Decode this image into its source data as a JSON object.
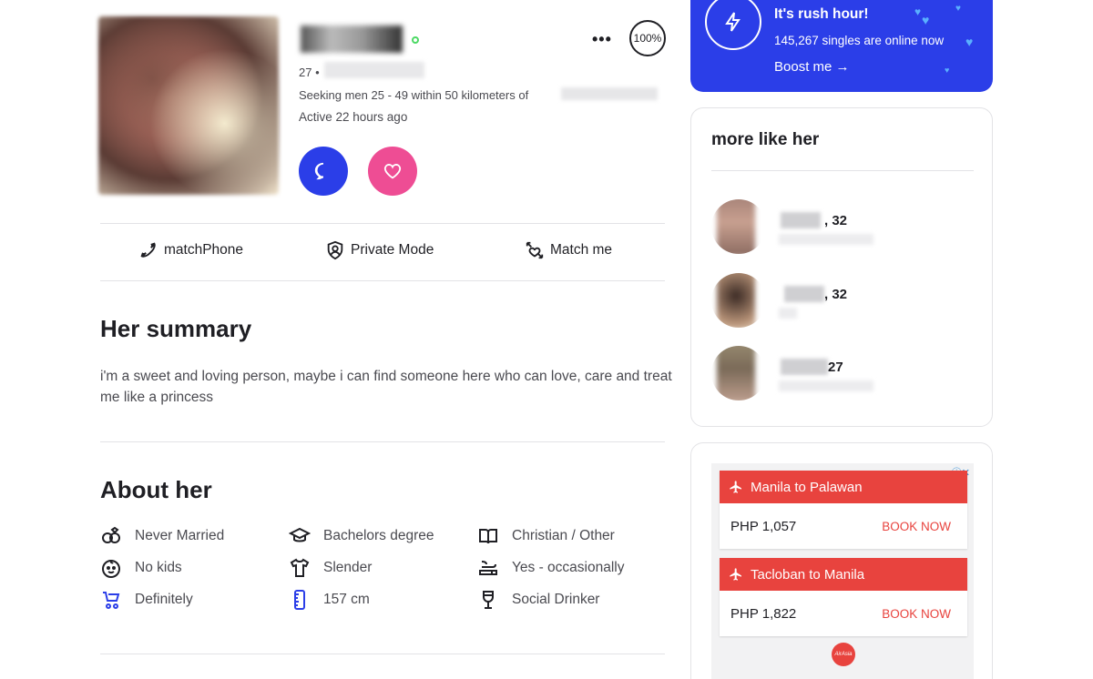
{
  "profile": {
    "age_prefix": "27 •",
    "seeking": "Seeking men 25 - 49 within 50 kilometers of",
    "active": "Active 22 hours ago",
    "match_score": "100%"
  },
  "actions": {
    "match_phone": "matchPhone",
    "private_mode": "Private Mode",
    "match_me": "Match me"
  },
  "summary": {
    "title": "Her summary",
    "text": "i'm a sweet and loving person, maybe i can find someone here who can love, care and treat me like a princess"
  },
  "about": {
    "title": "About her",
    "items": [
      {
        "icon": "rings-icon",
        "label": "Never Married"
      },
      {
        "icon": "graduation-cap-icon",
        "label": "Bachelors degree"
      },
      {
        "icon": "book-icon",
        "label": "Christian / Other"
      },
      {
        "icon": "baby-face-icon",
        "label": "No kids"
      },
      {
        "icon": "shirt-icon",
        "label": "Slender"
      },
      {
        "icon": "smoking-icon",
        "label": "Yes - occasionally"
      },
      {
        "icon": "stroller-icon",
        "label": "Definitely"
      },
      {
        "icon": "ruler-icon",
        "label": "157 cm"
      },
      {
        "icon": "wine-glass-icon",
        "label": "Social Drinker"
      }
    ]
  },
  "rush": {
    "title": "It's rush hour!",
    "subtitle": "145,267 singles are online now",
    "boost": "Boost me →"
  },
  "more_like": {
    "title": "more like her",
    "people": [
      {
        "age": ", 32"
      },
      {
        "age": ", 32"
      },
      {
        "age": " 27"
      }
    ]
  },
  "ad": {
    "adchoices": "ⓘ✕",
    "flights": [
      {
        "route": "Manila to Palawan",
        "price": "PHP 1,057",
        "cta": "BOOK NOW"
      },
      {
        "route": "Tacloban to Manila",
        "price": "PHP 1,822",
        "cta": "BOOK NOW"
      }
    ],
    "logo": "AirAsia"
  },
  "colors": {
    "primary_blue": "#2b3ee8",
    "like_pink": "#ee4d94",
    "ad_red": "#e8433e"
  }
}
